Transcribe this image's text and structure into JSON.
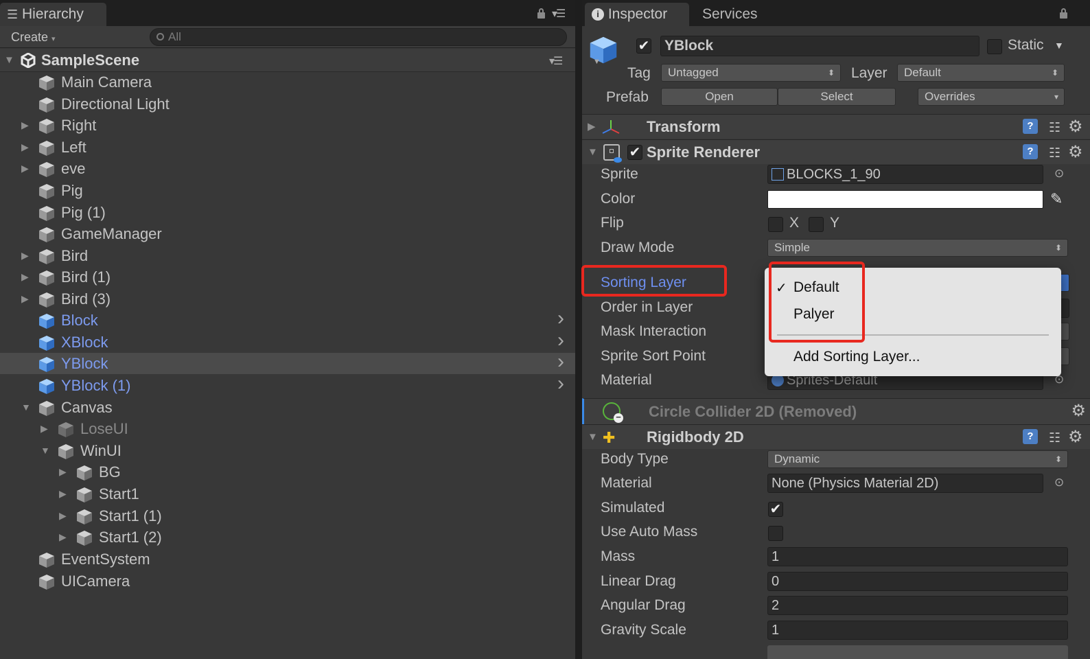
{
  "hierarchy": {
    "tab": "Hierarchy",
    "create": "Create",
    "search_placeholder": "All",
    "scene": "SampleScene",
    "items": [
      {
        "label": "Main Camera"
      },
      {
        "label": "Directional Light"
      },
      {
        "label": "Right"
      },
      {
        "label": "Left"
      },
      {
        "label": "eve"
      },
      {
        "label": "Pig"
      },
      {
        "label": "Pig (1)"
      },
      {
        "label": "GameManager"
      },
      {
        "label": "Bird"
      },
      {
        "label": "Bird (1)"
      },
      {
        "label": "Bird (3)"
      },
      {
        "label": "Block"
      },
      {
        "label": "XBlock"
      },
      {
        "label": "YBlock"
      },
      {
        "label": "YBlock (1)"
      },
      {
        "label": "Canvas"
      },
      {
        "label": "LoseUI"
      },
      {
        "label": "WinUI"
      },
      {
        "label": "BG"
      },
      {
        "label": "Start1"
      },
      {
        "label": "Start1 (1)"
      },
      {
        "label": "Start1 (2)"
      },
      {
        "label": "EventSystem"
      },
      {
        "label": "UICamera"
      }
    ]
  },
  "inspector": {
    "tabs": [
      "Inspector",
      "Services"
    ],
    "object_name": "YBlock",
    "static_label": "Static",
    "tag_label": "Tag",
    "tag_value": "Untagged",
    "layer_label": "Layer",
    "layer_value": "Default",
    "prefab_label": "Prefab",
    "open": "Open",
    "select": "Select",
    "overrides": "Overrides",
    "transform": "Transform",
    "sprite_renderer": {
      "title": "Sprite Renderer",
      "sprite_label": "Sprite",
      "sprite_value": "BLOCKS_1_90",
      "color_label": "Color",
      "color_value": "#ffffff",
      "flip_label": "Flip",
      "flip_x": "X",
      "flip_y": "Y",
      "draw_mode_label": "Draw Mode",
      "draw_mode_value": "Simple",
      "sorting_layer_label": "Sorting Layer",
      "order_label": "Order in Layer",
      "mask_label": "Mask Interaction",
      "sort_point_label": "Sprite Sort Point",
      "material_label": "Material",
      "material_value": "Sprites-Default"
    },
    "circle_collider": "Circle Collider 2D (Removed)",
    "rigidbody": {
      "title": "Rigidbody 2D",
      "body_type_label": "Body Type",
      "body_type_value": "Dynamic",
      "material_label": "Material",
      "material_value": "None (Physics Material 2D)",
      "simulated_label": "Simulated",
      "auto_mass_label": "Use Auto Mass",
      "mass_label": "Mass",
      "mass_value": "1",
      "linear_drag_label": "Linear Drag",
      "linear_drag_value": "0",
      "angular_drag_label": "Angular Drag",
      "angular_drag_value": "2",
      "gravity_label": "Gravity Scale",
      "gravity_value": "1"
    },
    "popup": {
      "items": [
        "Default",
        "Palyer"
      ],
      "selected": "Default",
      "add": "Add Sorting Layer..."
    }
  },
  "colors": {
    "highlight": "#e8281f",
    "selected_text": "#7d9bef",
    "accent_blue": "#4d7fc4"
  }
}
